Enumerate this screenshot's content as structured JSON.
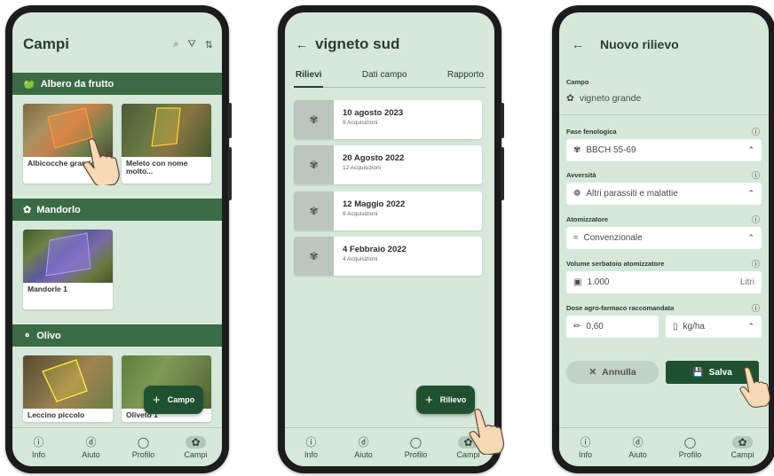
{
  "phone1": {
    "title": "Campi",
    "header_icons": {
      "search": "⌕",
      "filter": "⛛",
      "sort": "⇅"
    },
    "sections": [
      {
        "label": "Albero da frutto",
        "icon": "apple-icon"
      },
      {
        "label": "Mandorlo",
        "icon": "almond-icon"
      },
      {
        "label": "Olivo",
        "icon": "olive-icon"
      }
    ],
    "fields": [
      {
        "name": "Albicocche grande"
      },
      {
        "name": "Meleto con nome molto..."
      },
      {
        "name": "Mandorle 1"
      },
      {
        "name": "Leccino piccolo"
      },
      {
        "name": "Oliveto 1"
      }
    ],
    "fab_label": "Campo"
  },
  "phone2": {
    "title": "vigneto sud",
    "tabs": [
      "Rilievi",
      "Dati campo",
      "Rapporto"
    ],
    "rilievi": [
      {
        "date": "10 agosto 2023",
        "count": "9 Acquisizioni"
      },
      {
        "date": "20 Agosto 2022",
        "count": "12 Acquisizioni"
      },
      {
        "date": "12 Maggio 2022",
        "count": "8 Acquisizioni"
      },
      {
        "date": "4 Febbraio 2022",
        "count": "4 Acquisizioni"
      }
    ],
    "fab_label": "Rilievo"
  },
  "phone3": {
    "title": "Nuovo rilievo",
    "campo_label": "Campo",
    "campo_value": "vigneto grande",
    "fase_label": "Fase fenologica",
    "fase_value": "BBCH 55-69",
    "avversita_label": "Avversità",
    "avversita_value": "Altri parassiti e malattie",
    "atomizzatore_label": "Atomizzatore",
    "atomizzatore_value": "Convenzionale",
    "volume_label": "Volume serbatoio atomizzatore",
    "volume_value": "1.000",
    "volume_unit": "Litri",
    "dose_label": "Dose agro-farmaco raccomandata",
    "dose_value": "0,60",
    "dose_unit": "kg/ha",
    "annulla": "Annulla",
    "salva": "Salva"
  },
  "nav": [
    "Info",
    "Aiuto",
    "Profilo",
    "Campi"
  ],
  "colors": {
    "background": "#d5e8da",
    "accent": "#1f5130",
    "band": "#3a6b45"
  }
}
